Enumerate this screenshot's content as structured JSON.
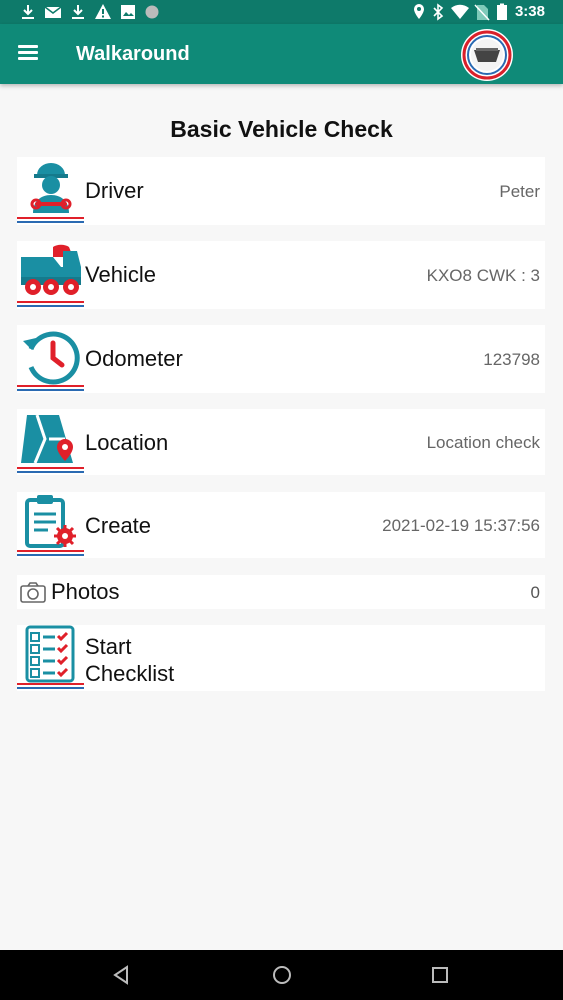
{
  "status_bar": {
    "time": "3:38",
    "left_icons": [
      "download-icon",
      "mail-icon",
      "download-icon",
      "warning-icon",
      "image-icon",
      "circle-icon"
    ],
    "right_icons": [
      "location-icon",
      "bluetooth-icon",
      "wifi-icon",
      "no-sim-icon",
      "battery-icon"
    ]
  },
  "app_bar": {
    "title": "Walkaround",
    "menu_icon": "hamburger-menu-icon",
    "logo_icon": "skip-logo-icon",
    "color": "#0f8a78"
  },
  "page": {
    "heading": "Basic Vehicle Check"
  },
  "rows": [
    {
      "label": "Driver",
      "value": "Peter",
      "icon": "driver-icon"
    },
    {
      "label": "Vehicle",
      "value": "KXO8 CWK : 3",
      "icon": "truck-icon"
    },
    {
      "label": "Odometer",
      "value": "123798",
      "icon": "odometer-clock-icon"
    },
    {
      "label": "Location",
      "value": "Location check",
      "icon": "map-pin-icon"
    },
    {
      "label": "Create",
      "value": "2021-02-19 15:37:56",
      "icon": "clipboard-gear-icon"
    }
  ],
  "photos": {
    "label": "Photos",
    "value": "0",
    "icon": "camera-icon"
  },
  "checklist": {
    "label_line1": "Start",
    "label_line2": "Checklist",
    "icon": "checklist-icon"
  },
  "colors": {
    "accent_teal": "#1a8fa3",
    "accent_red": "#e0202a",
    "underline_blue": "#2a6ab2"
  },
  "nav": {
    "back_icon": "back-triangle-icon",
    "home_icon": "home-circle-icon",
    "recents_icon": "recents-square-icon"
  }
}
